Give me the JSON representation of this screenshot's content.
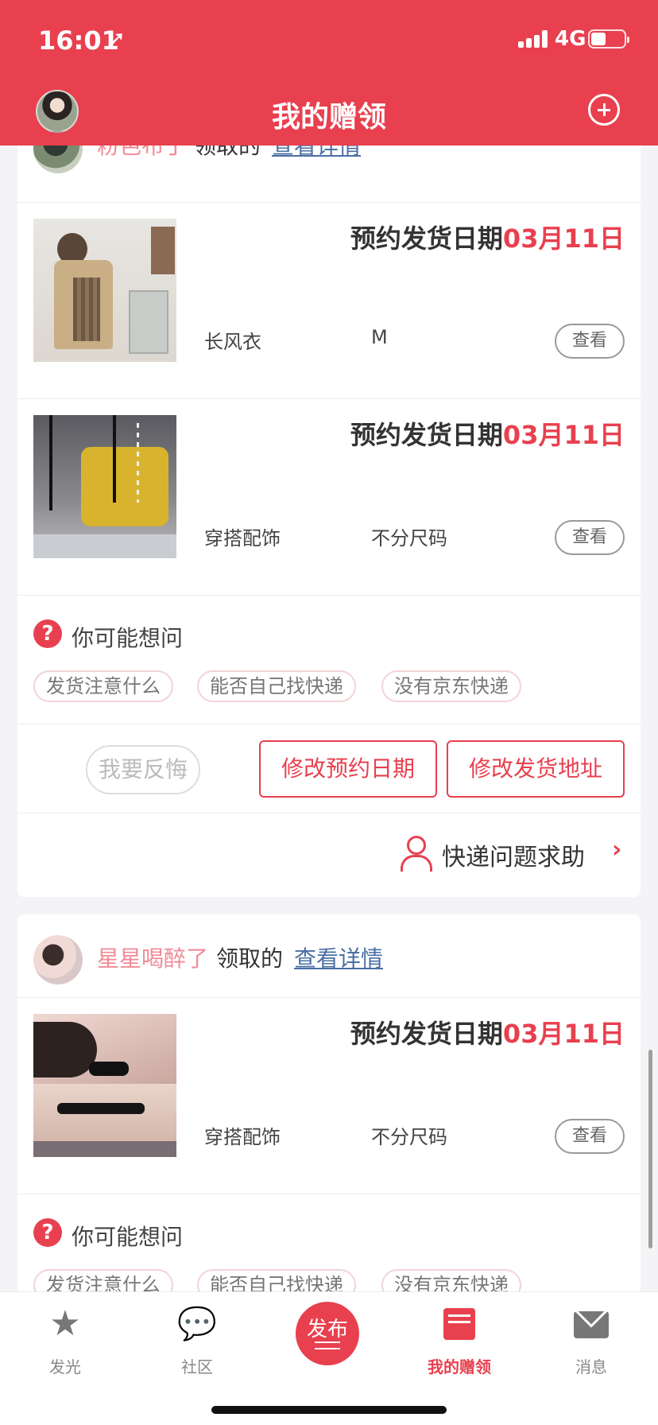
{
  "status_bar": {
    "time": "16:01",
    "network": "4G"
  },
  "header": {
    "title": "我的赠领"
  },
  "cards": [
    {
      "giver": {
        "name": "粉色布丁",
        "action": "领取的",
        "link": "查看详情"
      },
      "items": [
        {
          "ship_label": "预约发货日期",
          "ship_date": "03月11日",
          "name": "长风衣",
          "size": "M",
          "view": "查看"
        },
        {
          "ship_label": "预约发货日期",
          "ship_date": "03月11日",
          "name": "穿搭配饰",
          "size": "不分尺码",
          "view": "查看"
        }
      ],
      "faq": {
        "title": "你可能想问",
        "tags": [
          "发货注意什么",
          "能否自己找快递",
          "没有京东快递"
        ]
      },
      "actions": {
        "regret": "我要反悔",
        "change_date": "修改预约日期",
        "change_address": "修改发货地址"
      },
      "help": {
        "text": "快递问题求助"
      }
    },
    {
      "giver": {
        "name": "星星喝醉了",
        "action": "领取的",
        "link": "查看详情"
      },
      "items": [
        {
          "ship_label": "预约发货日期",
          "ship_date": "03月11日",
          "name": "穿搭配饰",
          "size": "不分尺码",
          "view": "查看"
        }
      ],
      "faq": {
        "title": "你可能想问",
        "tags": [
          "发货注意什么",
          "能否自己找快递",
          "没有京东快递"
        ]
      }
    }
  ],
  "tabbar": {
    "tabs": [
      {
        "label": "发光",
        "icon": "star-icon"
      },
      {
        "label": "社区",
        "icon": "chat-bubble-icon"
      },
      {
        "label": "发布",
        "icon": "publish-icon"
      },
      {
        "label": "我的赠领",
        "icon": "gift-book-icon"
      },
      {
        "label": "消息",
        "icon": "envelope-icon"
      }
    ],
    "active_index": 3
  },
  "colors": {
    "brand": "#e8404f",
    "link": "#4a6fa5",
    "giver_name": "#f08a94"
  }
}
